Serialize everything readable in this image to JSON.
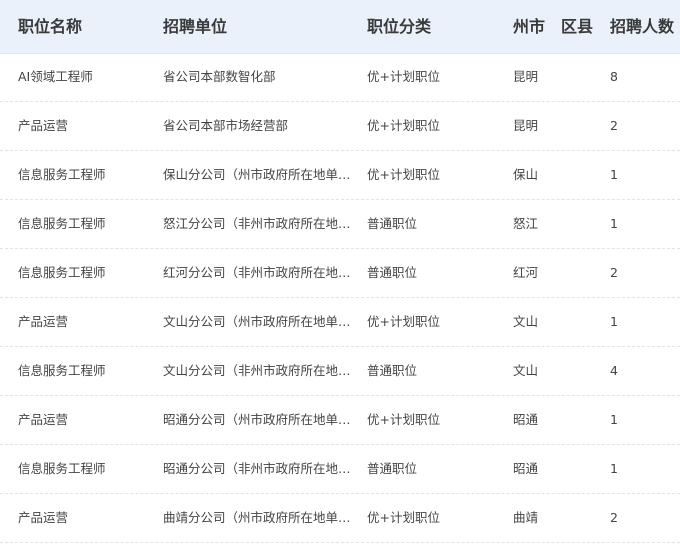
{
  "headers": {
    "title": "职位名称",
    "unit": "招聘单位",
    "category": "职位分类",
    "city": "州市",
    "district": "区县",
    "count": "招聘人数"
  },
  "rows": [
    {
      "title": "AI领域工程师",
      "unit": "省公司本部数智化部",
      "category": "优+计划职位",
      "city": "昆明",
      "district": "",
      "count": "8"
    },
    {
      "title": "产品运营",
      "unit": "省公司本部市场经营部",
      "category": "优+计划职位",
      "city": "昆明",
      "district": "",
      "count": "2"
    },
    {
      "title": "信息服务工程师",
      "unit": "保山分公司（州市政府所在地单位）",
      "category": "优+计划职位",
      "city": "保山",
      "district": "",
      "count": "1"
    },
    {
      "title": "信息服务工程师",
      "unit": "怒江分公司（非州市政府所在地单...",
      "category": "普通职位",
      "city": "怒江",
      "district": "",
      "count": "1"
    },
    {
      "title": "信息服务工程师",
      "unit": "红河分公司（非州市政府所在地单...",
      "category": "普通职位",
      "city": "红河",
      "district": "",
      "count": "2"
    },
    {
      "title": "产品运营",
      "unit": "文山分公司（州市政府所在地单位）",
      "category": "优+计划职位",
      "city": "文山",
      "district": "",
      "count": "1"
    },
    {
      "title": "信息服务工程师",
      "unit": "文山分公司（非州市政府所在地单...",
      "category": "普通职位",
      "city": "文山",
      "district": "",
      "count": "4"
    },
    {
      "title": "产品运营",
      "unit": "昭通分公司（州市政府所在地单位）",
      "category": "优+计划职位",
      "city": "昭通",
      "district": "",
      "count": "1"
    },
    {
      "title": "信息服务工程师",
      "unit": "昭通分公司（非州市政府所在地单...",
      "category": "普通职位",
      "city": "昭通",
      "district": "",
      "count": "1"
    },
    {
      "title": "产品运营",
      "unit": "曲靖分公司（州市政府所在地单位）",
      "category": "优+计划职位",
      "city": "曲靖",
      "district": "",
      "count": "2"
    }
  ]
}
